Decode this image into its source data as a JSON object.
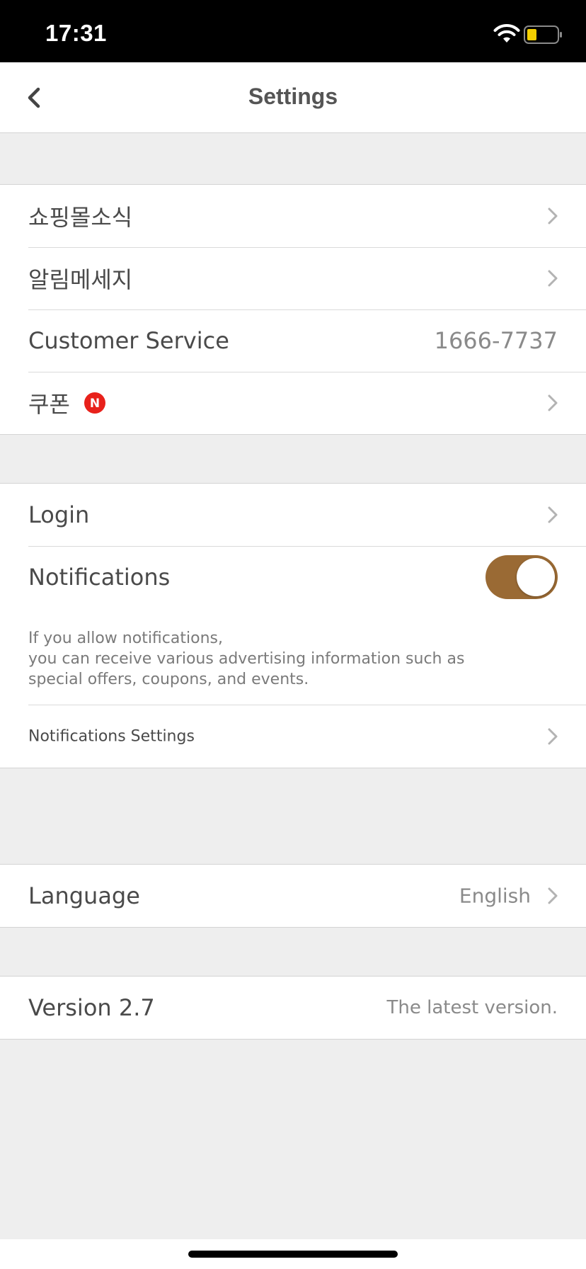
{
  "status_bar": {
    "time": "17:31",
    "wifi_icon": "wifi-icon",
    "battery_icon": "battery-low-icon",
    "battery_color": "#f5d000"
  },
  "header": {
    "title": "Settings",
    "back_icon": "chevron-left-icon"
  },
  "group_one": {
    "items": [
      {
        "label": "쇼핑몰소식",
        "icon": "chevron-right-icon"
      },
      {
        "label": "알림메세지",
        "icon": "chevron-right-icon"
      },
      {
        "label": "Customer Service",
        "value": "1666-7737"
      },
      {
        "label": "쿠폰",
        "badge": "N",
        "badge_color": "#e8211b",
        "icon": "chevron-right-icon"
      }
    ]
  },
  "group_two": {
    "login_label": "Login",
    "notifications_label": "Notifications",
    "notifications_enabled": true,
    "toggle_color": "#9a6a34",
    "notification_note": [
      "If you allow notifications,",
      "you can receive various advertising information such as",
      "special offers, coupons, and events."
    ],
    "notifications_settings_label": "Notifications Settings"
  },
  "group_three": {
    "language_label": "Language",
    "language_value": "English"
  },
  "group_four": {
    "version_label": "Version 2.7",
    "version_status": "The latest version."
  }
}
